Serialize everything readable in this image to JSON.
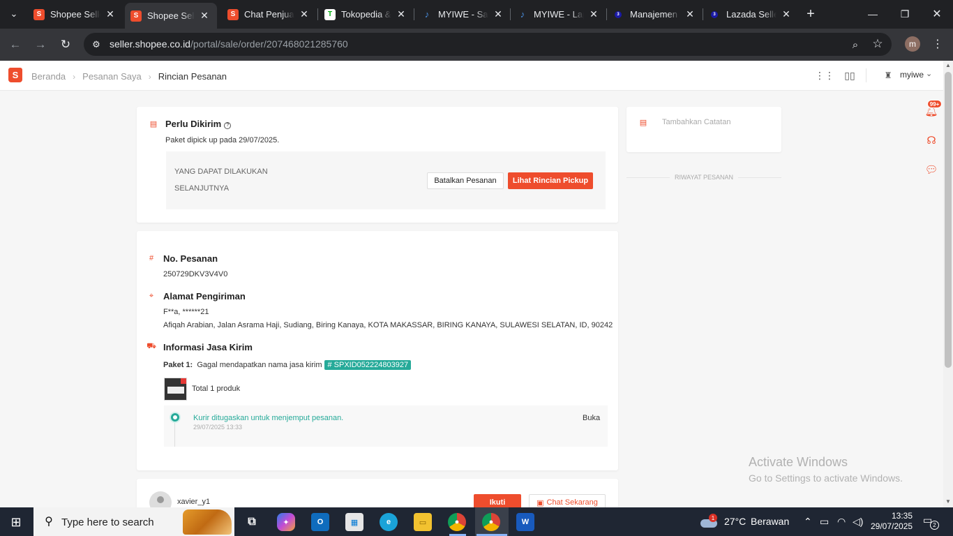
{
  "browser": {
    "tabs": [
      {
        "title": "Shopee Seller Centre",
        "favicon": "shopee-bag-icon",
        "active": false
      },
      {
        "title": "Shopee Seller Centre",
        "favicon": "shopee-bag-icon",
        "active": true
      },
      {
        "title": "Chat Penjual",
        "favicon": "shopee-bag-icon",
        "active": false
      },
      {
        "title": "Tokopedia & ShopTokopedia",
        "favicon": "tokopedia-icon",
        "active": false
      },
      {
        "title": "MYIWE - Sales",
        "favicon": "myiwe-icon",
        "active": false
      },
      {
        "title": "MYIWE - Laporan",
        "favicon": "myiwe-icon",
        "active": false
      },
      {
        "title": "Manajemen Pesanan",
        "favicon": "lazada-icon",
        "active": false
      },
      {
        "title": "Lazada Seller Center",
        "favicon": "lazada-icon",
        "active": false
      }
    ],
    "url_domain": "seller.shopee.co.id",
    "url_path": "/portal/sale/order/207468021285760",
    "profile_initial": "m"
  },
  "header": {
    "breadcrumbs": [
      "Beranda",
      "Pesanan Saya",
      "Rincian Pesanan"
    ],
    "shop_name": "myiwe"
  },
  "status_card": {
    "title": "Perlu Dikirim",
    "subtitle": "Paket dipick up pada 29/07/2025.",
    "next_label_line1": "YANG DAPAT DILAKUKAN",
    "next_label_line2": "SELANJUTNYA",
    "cancel_label": "Batalkan Pesanan",
    "pickup_label": "Lihat Rincian Pickup"
  },
  "order_card": {
    "order_no_title": "No. Pesanan",
    "order_no": "250729DKV3V4V0",
    "address_title": "Alamat Pengiriman",
    "recipient": "F**a, ******21",
    "address": "Afiqah Arabian, Jalan Asrama Haji, Sudiang, Biring Kanaya, KOTA MAKASSAR, BIRING KANAYA, SULAWESI SELATAN, ID, 90242",
    "shipping_title": "Informasi Jasa Kirim",
    "package_label": "Paket 1:",
    "package_text": "Gagal mendapatkan nama jasa kirim",
    "tracking_no": "# SPXID052224803927",
    "total_products": "Total 1 produk",
    "timeline_text": "Kurir ditugaskan untuk menjemput pesanan.",
    "timeline_time": "29/07/2025 13:33",
    "open_label": "Buka"
  },
  "buyer_card": {
    "username": "xavier_y1",
    "follow_label": "Ikuti",
    "chat_label": "Chat Sekarang"
  },
  "side_panel": {
    "add_note_label": "Tambahkan Catatan",
    "history_label": "RIWAYAT PESANAN"
  },
  "floating": {
    "badge": "99+"
  },
  "watermark": {
    "line1": "Activate Windows",
    "line2": "Go to Settings to activate Windows."
  },
  "taskbar": {
    "search_placeholder": "Type here to search",
    "weather_badge": "1",
    "temperature": "27°C",
    "weather": "Berawan",
    "time": "13:35",
    "date": "29/07/2025",
    "notifications": "2"
  },
  "colors": {
    "brand": "#ee4d2d",
    "teal": "#26aa99"
  }
}
